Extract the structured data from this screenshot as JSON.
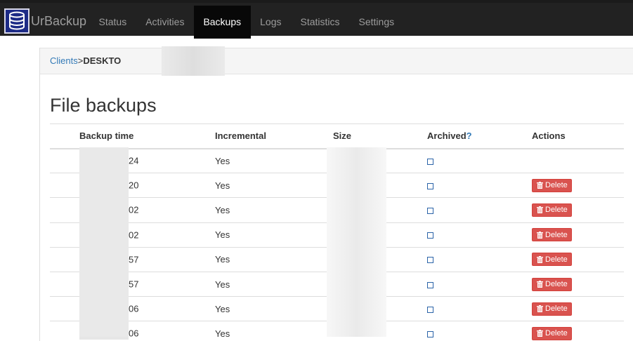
{
  "brand": {
    "name": "UrBackup"
  },
  "nav": [
    "Status",
    "Activities",
    "Backups",
    "Logs",
    "Statistics",
    "Settings"
  ],
  "nav_active": "Backups",
  "breadcrumb": {
    "link": "Clients",
    "sep": ">",
    "current": "DESKTO"
  },
  "page_title": "File backups",
  "table": {
    "headers": {
      "time": "Backup time",
      "incremental": "Incremental",
      "size": "Size",
      "archived": "Archived",
      "archived_help": "?",
      "actions": "Actions"
    },
    "rows": [
      {
        "time_suffix": "24",
        "incremental": "Yes",
        "has_delete": false
      },
      {
        "time_suffix": "20",
        "incremental": "Yes",
        "has_delete": true
      },
      {
        "time_suffix": "02",
        "incremental": "Yes",
        "has_delete": true
      },
      {
        "time_suffix": "02",
        "incremental": "Yes",
        "has_delete": true
      },
      {
        "time_suffix": "57",
        "incremental": "Yes",
        "has_delete": true
      },
      {
        "time_suffix": "57",
        "incremental": "Yes",
        "has_delete": true
      },
      {
        "time_suffix": "06",
        "incremental": "Yes",
        "has_delete": true
      },
      {
        "time_suffix": "06",
        "incremental": "Yes",
        "has_delete": true
      }
    ],
    "delete_label": "Delete"
  },
  "colors": {
    "navbar": "#222222",
    "active_nav": "#080808",
    "link": "#337ab7",
    "danger": "#d9534f",
    "logo_bg": "#1c2a86"
  }
}
